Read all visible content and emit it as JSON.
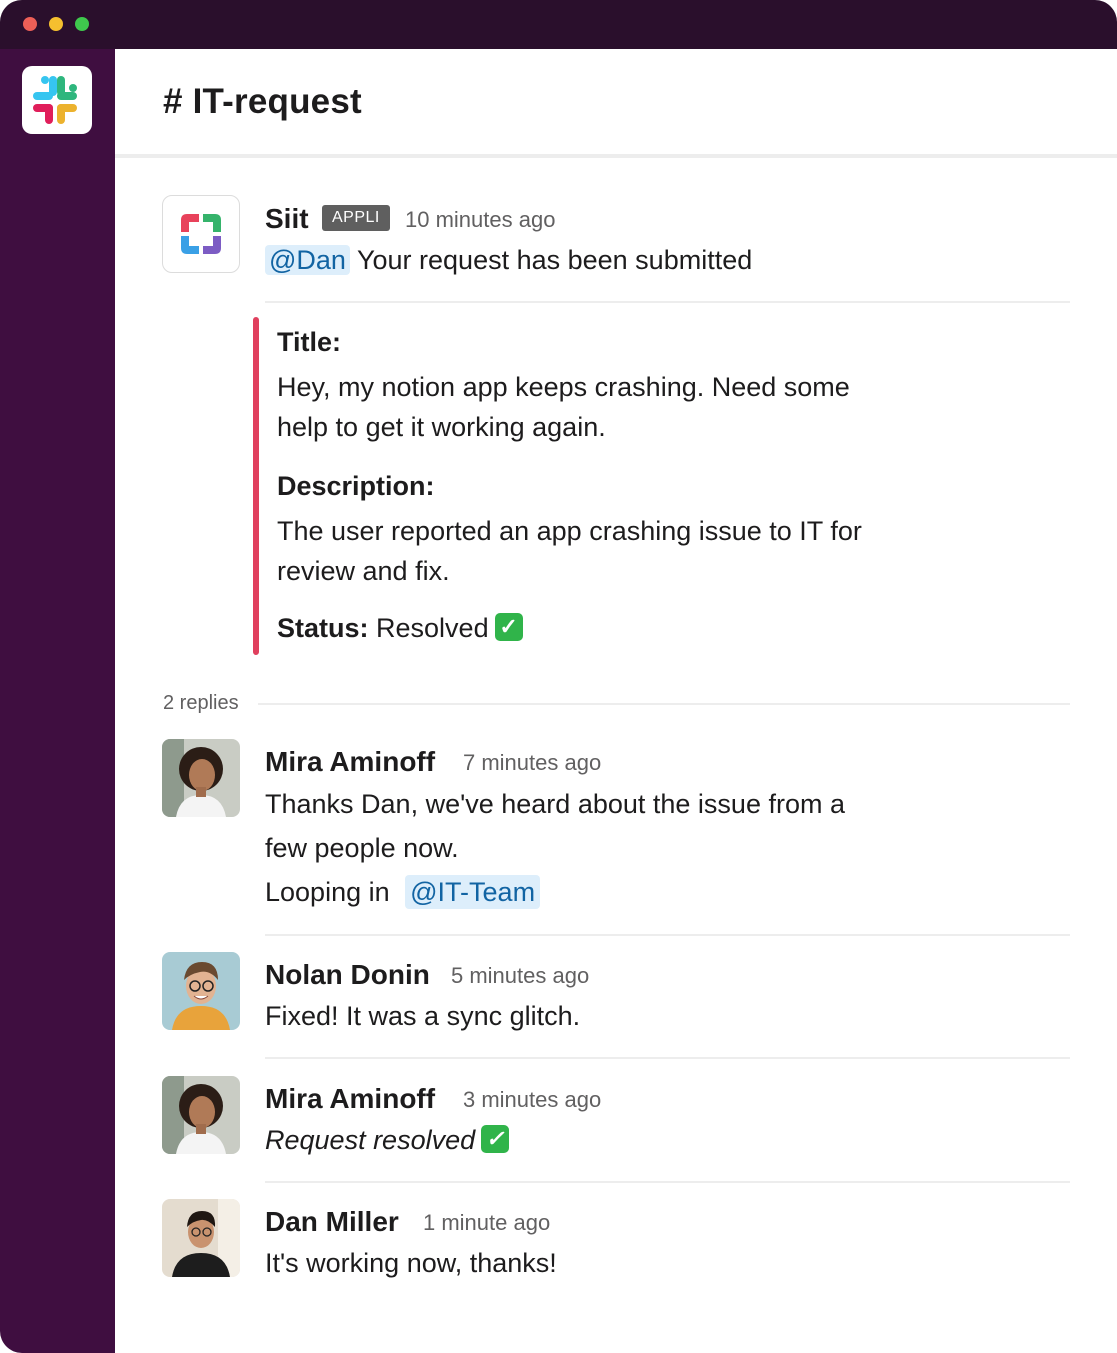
{
  "window": {
    "controls": [
      "close",
      "minimize",
      "maximize"
    ]
  },
  "sidebar": {
    "workspace_icon": "slack-logo-icon"
  },
  "channel": {
    "title": "# IT-request"
  },
  "bot_message": {
    "author": "Siit",
    "badge": "APPLI",
    "time": "10 minutes ago",
    "mention": "@Dan",
    "text": "Your request has been submitted",
    "title_label": "Title:",
    "title_value": "Hey, my notion app keeps crashing. Need some help to get it  working again.",
    "description_label": "Description:",
    "description_value": "The user reported an app crashing issue to IT for review and fix.",
    "status_label": "Status:",
    "status_value": "Resolved",
    "status_icon": "white-check-mark-icon"
  },
  "thread": {
    "replies_label": "2 replies",
    "messages": [
      {
        "author": "Mira Aminoff",
        "time": "7 minutes ago",
        "line1": "Thanks Dan, we've heard about the issue from a",
        "line2": "few people now.",
        "line3_prefix": "Looping in",
        "mention": "@IT-Team"
      },
      {
        "author": "Nolan Donin",
        "time": "5 minutes ago",
        "text": "Fixed! It was a sync glitch."
      },
      {
        "author": "Mira Aminoff",
        "time": "3 minutes ago",
        "text": "Request resolved",
        "icon": "white-check-mark-icon"
      },
      {
        "author": "Dan Miller",
        "time": "1 minute ago",
        "text": "It's working now, thanks!"
      }
    ]
  },
  "colors": {
    "sidebar": "#3f0e40",
    "titlebar": "#2a0f2c",
    "quote_bar": "#e0405e",
    "mention_bg": "#ddeefb",
    "mention_text": "#1264a3"
  }
}
